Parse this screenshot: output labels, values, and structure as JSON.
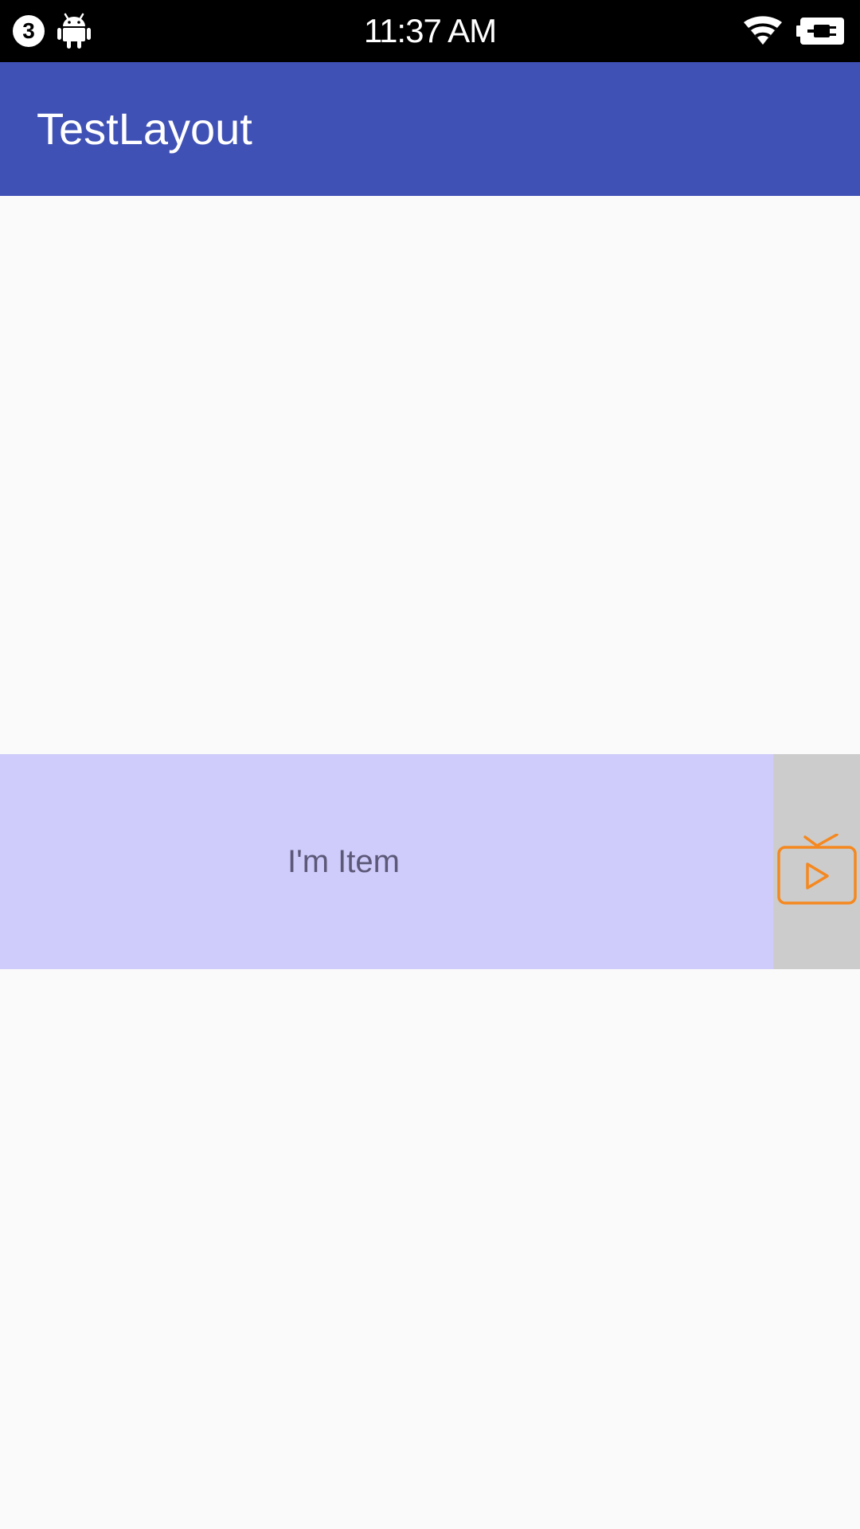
{
  "status_bar": {
    "notification_count": "3",
    "time": "11:37 AM",
    "icons": [
      "notification-count-badge",
      "android-icon",
      "wifi-icon",
      "battery-charging-icon"
    ]
  },
  "app_bar": {
    "title": "TestLayout",
    "color": "#3f51b5"
  },
  "list": {
    "item_label": "I'm Item",
    "item_color": "#cfcbfa",
    "action_icon": "tv-play-icon",
    "action_background": "#cccccc",
    "action_icon_color": "#f5881f"
  }
}
